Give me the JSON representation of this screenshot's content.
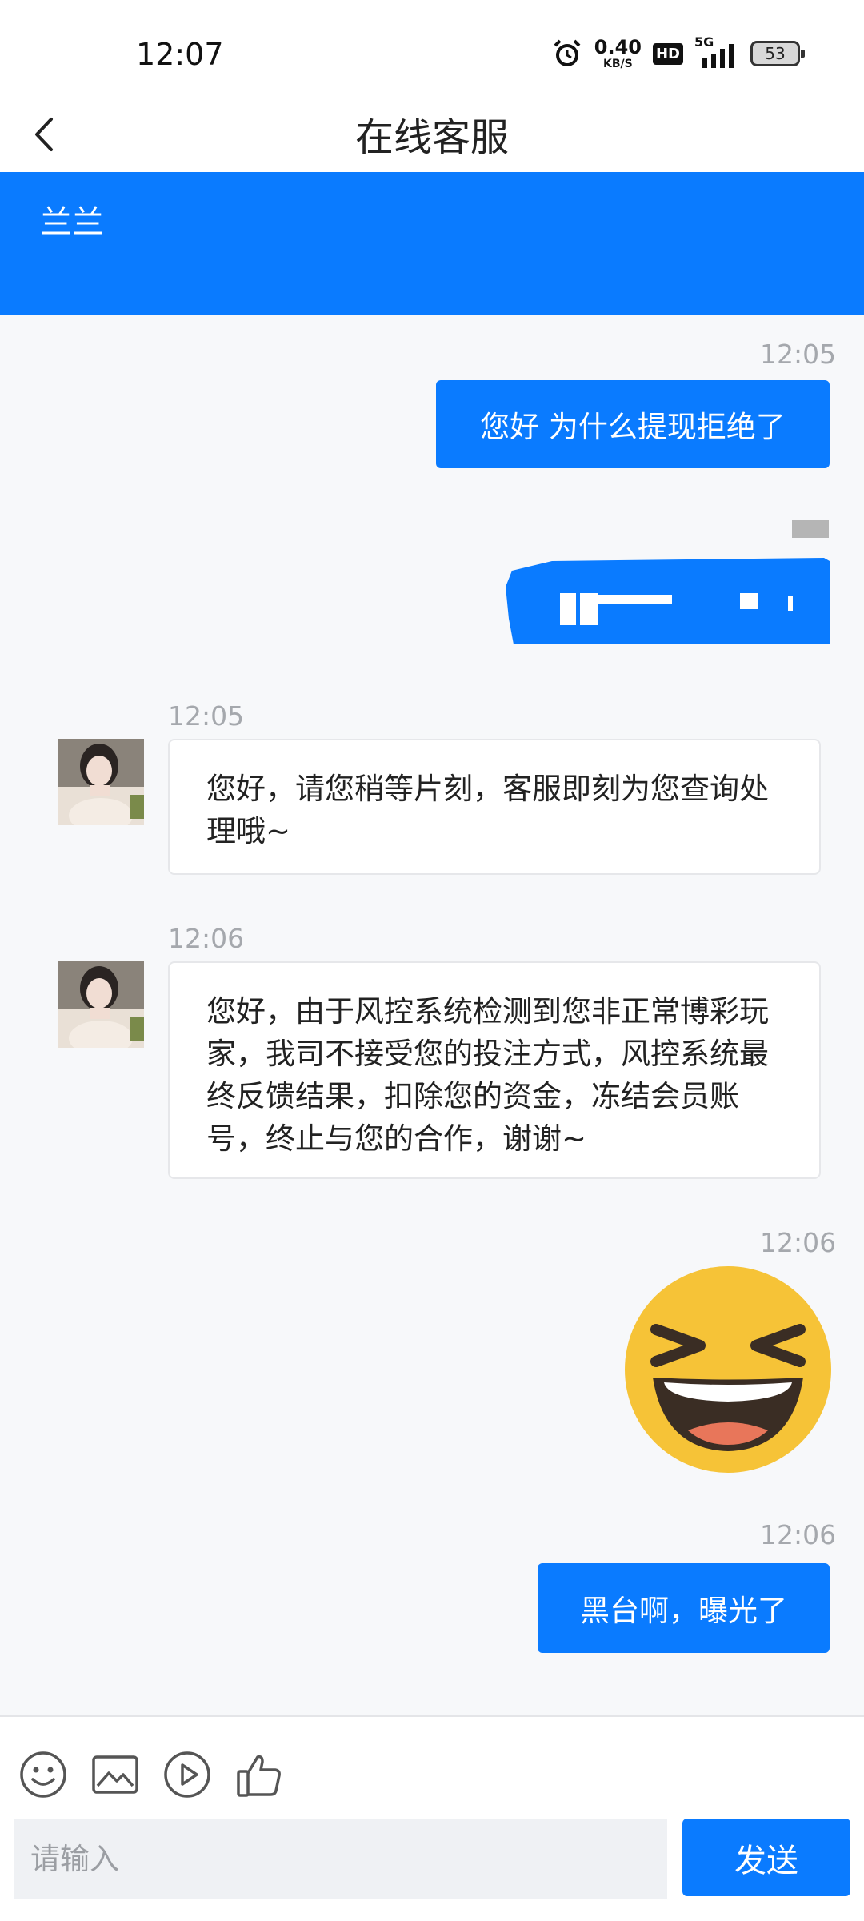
{
  "status_bar": {
    "time": "12:07",
    "net_speed_value": "0.40",
    "net_speed_unit": "KB/S",
    "hd_label": "HD",
    "signal_label": "5G",
    "battery_level": "53"
  },
  "header": {
    "title": "在线客服",
    "back_icon": "chevron-left-icon"
  },
  "banner": {
    "agent_name": "兰兰",
    "color": "#0a7bff"
  },
  "messages": [
    {
      "direction": "outgoing",
      "time": "12:05",
      "text": "您好 为什么提现拒绝了"
    },
    {
      "direction": "outgoing",
      "time": "",
      "text": "",
      "redacted": true
    },
    {
      "direction": "incoming",
      "time": "12:05",
      "text": "您好，请您稍等片刻，客服即刻为您查询处理哦~"
    },
    {
      "direction": "incoming",
      "time": "12:06",
      "text": "您好，由于风控系统检测到您非正常博彩玩家，我司不接受您的投注方式，风控系统最终反馈结果，扣除您的资金，冻结会员账号，终止与您的合作，谢谢~"
    },
    {
      "direction": "outgoing",
      "time": "12:06",
      "type": "emoji",
      "emoji": "laughing-face"
    },
    {
      "direction": "outgoing",
      "time": "12:06",
      "text": "黑台啊，曝光了"
    }
  ],
  "toolbar": {
    "icons": [
      "smiley-icon",
      "image-icon",
      "play-icon",
      "thumbs-up-icon"
    ]
  },
  "input": {
    "placeholder": "请输入",
    "value": ""
  },
  "send_label": "发送",
  "colors": {
    "accent": "#0a7bff",
    "background": "#f7f8fa",
    "timestamp": "#a5a8ad"
  }
}
